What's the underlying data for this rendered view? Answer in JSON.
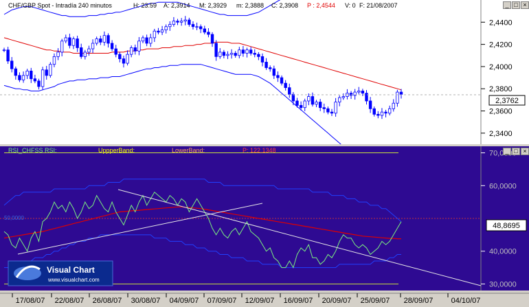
{
  "price_header": {
    "instrument": "CHF/GBP Spot - Intradía 240 minutos",
    "h": "H: 23:59",
    "a": "A: 2,3914",
    "m": "M: 2,3929",
    "mn": "m: 2,3888",
    "c": "C: 2,3908",
    "p": "P : 2,4544",
    "v": "V: 0",
    "date": "F: 21/08/2007"
  },
  "rsi_header": {
    "label": "RSI_CHFSS  RSI:",
    "upper": "UppperBand:",
    "lower": "LowerBand:",
    "p": "P: 122,1348"
  },
  "price_axis": [
    "2,4400",
    "2,4200",
    "2,4000",
    "2,3800",
    "2,3600",
    "2,3400"
  ],
  "price_last": "2,3762",
  "rsi_axis": [
    "70,0000",
    "60,0000",
    "48,8695",
    "40,0000",
    "30,0000"
  ],
  "rsi_label_left": "50,0000",
  "dates": [
    "17/08/07",
    "22/08/07",
    "26/08/07",
    "30/08/07",
    "04/09/07",
    "07/09/07",
    "12/09/07",
    "16/09/07",
    "20/09/07",
    "25/09/07",
    "28/09/07",
    "04/10/07"
  ],
  "logo": {
    "title": "Visual Chart",
    "url": "www.visualchart.com"
  },
  "colors": {
    "panel_bg": "#ffffff",
    "rsi_bg": "#2e0a92",
    "candle": "#0000ff",
    "ma": "#e00000",
    "band": "#0000ff",
    "rsi_line": "#7cf080",
    "level": "#c8e03c"
  },
  "chart_data": [
    {
      "type": "candlestick",
      "title": "CHF/GBP Spot - Intradía 240 minutos",
      "ylim": [
        2.33,
        2.46
      ],
      "close": [
        2.415,
        2.405,
        2.398,
        2.392,
        2.388,
        2.392,
        2.396,
        2.389,
        2.387,
        2.382,
        2.397,
        2.392,
        2.402,
        2.409,
        2.413,
        2.423,
        2.426,
        2.419,
        2.425,
        2.417,
        2.409,
        2.413,
        2.416,
        2.421,
        2.425,
        2.422,
        2.428,
        2.421,
        2.416,
        2.411,
        2.407,
        2.403,
        2.411,
        2.417,
        2.414,
        2.423,
        2.426,
        2.421,
        2.426,
        2.432,
        2.431,
        2.433,
        2.436,
        2.438,
        2.441,
        2.44,
        2.441,
        2.442,
        2.438,
        2.436,
        2.436,
        2.434,
        2.431,
        2.429,
        2.421,
        2.409,
        2.413,
        2.41,
        2.411,
        2.412,
        2.41,
        2.415,
        2.412,
        2.415,
        2.412,
        2.411,
        2.409,
        2.404,
        2.399,
        2.398,
        2.392,
        2.39,
        2.385,
        2.381,
        2.375,
        2.369,
        2.365,
        2.363,
        2.369,
        2.373,
        2.366,
        2.368,
        2.363,
        2.362,
        2.359,
        2.358,
        2.368,
        2.372,
        2.373,
        2.376,
        2.374,
        2.377,
        2.378,
        2.376,
        2.369,
        2.362,
        2.357,
        2.356,
        2.359,
        2.358,
        2.362,
        2.367,
        2.377,
        2.375
      ],
      "ma": [
        2.426,
        2.425,
        2.424,
        2.423,
        2.422,
        2.421,
        2.42,
        2.419,
        2.418,
        2.417,
        2.416,
        2.415,
        2.415,
        2.414,
        2.414,
        2.413,
        2.413,
        2.413,
        2.412,
        2.412,
        2.412,
        2.412,
        2.412,
        2.412,
        2.412,
        2.412,
        2.412,
        2.412,
        2.413,
        2.413,
        2.413,
        2.413,
        2.414,
        2.414,
        2.414,
        2.415,
        2.415,
        2.416,
        2.416,
        2.416,
        2.416,
        2.417,
        2.417,
        2.417,
        2.418,
        2.418,
        2.418,
        2.419,
        2.419,
        2.419,
        2.42,
        2.42,
        2.421,
        2.421,
        2.421,
        2.422,
        2.422,
        2.422,
        2.422,
        2.421,
        2.421,
        2.421,
        2.42,
        2.419,
        2.418,
        2.417,
        2.416,
        2.415,
        2.414,
        2.413,
        2.412,
        2.411,
        2.41,
        2.409,
        2.408,
        2.407,
        2.406,
        2.405,
        2.404,
        2.403,
        2.402,
        2.401,
        2.4,
        2.399,
        2.398,
        2.397,
        2.396,
        2.395,
        2.394,
        2.393,
        2.392,
        2.391,
        2.39,
        2.389,
        2.388,
        2.387,
        2.386,
        2.385,
        2.384,
        2.383,
        2.382,
        2.381,
        2.38,
        2.379
      ],
      "upper_band": [
        2.447,
        2.449,
        2.451,
        2.452,
        2.453,
        2.454,
        2.454,
        2.454,
        2.453,
        2.452,
        2.451,
        2.45,
        2.449,
        2.448,
        2.447,
        2.446,
        2.446,
        2.445,
        2.445,
        2.445,
        2.445,
        2.445,
        2.446,
        2.446,
        2.446,
        2.447,
        2.447,
        2.448,
        2.448,
        2.449,
        2.449,
        2.45,
        2.451,
        2.452,
        2.453,
        2.454,
        2.455,
        2.456,
        2.457,
        2.457,
        2.458,
        2.458,
        2.458,
        2.458,
        2.458,
        2.458,
        2.457,
        2.456,
        2.455,
        2.454,
        2.453,
        2.452,
        2.451,
        2.45,
        2.449,
        2.448,
        2.447,
        2.447,
        2.446,
        2.446,
        2.446,
        2.446,
        2.446,
        2.446,
        2.447,
        2.448,
        2.449,
        2.451,
        2.453,
        2.455,
        2.457,
        2.459,
        2.461,
        2.463,
        2.465,
        2.467,
        2.469,
        2.471,
        2.473,
        2.475,
        2.477,
        2.479,
        2.481,
        2.483,
        2.485,
        2.487,
        2.489,
        2.491,
        2.493,
        2.495,
        2.497,
        2.499,
        2.501,
        2.503,
        2.505,
        2.507,
        2.509,
        2.511,
        2.513,
        2.515,
        2.517,
        2.519,
        2.521,
        2.523
      ],
      "lower_band": [
        2.383,
        2.382,
        2.381,
        2.38,
        2.38,
        2.379,
        2.379,
        2.378,
        2.378,
        2.378,
        2.379,
        2.38,
        2.381,
        2.382,
        2.384,
        2.385,
        2.386,
        2.387,
        2.387,
        2.388,
        2.388,
        2.388,
        2.389,
        2.389,
        2.389,
        2.39,
        2.39,
        2.39,
        2.391,
        2.391,
        2.391,
        2.392,
        2.393,
        2.394,
        2.395,
        2.396,
        2.397,
        2.398,
        2.398,
        2.399,
        2.399,
        2.4,
        2.4,
        2.401,
        2.401,
        2.401,
        2.402,
        2.402,
        2.402,
        2.402,
        2.402,
        2.402,
        2.401,
        2.4,
        2.399,
        2.398,
        2.397,
        2.396,
        2.395,
        2.394,
        2.393,
        2.393,
        2.393,
        2.393,
        2.393,
        2.392,
        2.391,
        2.389,
        2.387,
        2.385,
        2.382,
        2.379,
        2.376,
        2.373,
        2.37,
        2.367,
        2.364,
        2.361,
        2.358,
        2.355,
        2.352,
        2.349,
        2.346,
        2.343,
        2.34,
        2.337,
        2.334,
        2.331,
        2.328,
        2.325,
        2.322,
        2.319,
        2.316,
        2.313,
        2.31,
        2.307,
        2.304,
        2.301,
        2.298,
        2.295,
        2.292,
        2.289,
        2.286,
        2.283
      ]
    },
    {
      "type": "line",
      "title": "RSI_CHFSS",
      "ylim": [
        28,
        72
      ],
      "levels": [
        70,
        30
      ],
      "reference": 50,
      "rsi": [
        46,
        45,
        42,
        41,
        44,
        42,
        40,
        44,
        46,
        43,
        49,
        50,
        52,
        55,
        53,
        54,
        52,
        55,
        53,
        50,
        52,
        55,
        53,
        54,
        57,
        55,
        53,
        52,
        55,
        52,
        50,
        48,
        51,
        54,
        52,
        55,
        57,
        54,
        56,
        58,
        57,
        56,
        55,
        57,
        56,
        54,
        56,
        55,
        52,
        54,
        56,
        54,
        52,
        50,
        47,
        45,
        47,
        45,
        44,
        46,
        47,
        45,
        47,
        49,
        46,
        45,
        44,
        42,
        40,
        41,
        38,
        37,
        35,
        35,
        37,
        35,
        39,
        41,
        40,
        42,
        38,
        38,
        36,
        37,
        39,
        38,
        40,
        43,
        45,
        44,
        44,
        42,
        41,
        42,
        41,
        39,
        40,
        41,
        43,
        42,
        43,
        45,
        47,
        49
      ],
      "ma": [
        44.0,
        44.2,
        44.4,
        44.6,
        44.8,
        45.0,
        45.2,
        45.4,
        45.6,
        45.8,
        46.0,
        46.3,
        46.6,
        46.9,
        47.2,
        47.5,
        47.8,
        48.1,
        48.4,
        48.7,
        49.0,
        49.3,
        49.6,
        49.9,
        50.2,
        50.5,
        50.8,
        51.1,
        51.4,
        51.7,
        52.0,
        52.1,
        52.2,
        52.3,
        52.4,
        52.5,
        52.6,
        52.7,
        52.8,
        52.9,
        53.0,
        53.1,
        53.2,
        53.3,
        53.4,
        53.5,
        53.5,
        53.4,
        53.3,
        53.2,
        53.1,
        53.0,
        52.8,
        52.6,
        52.4,
        52.2,
        52.0,
        51.8,
        51.6,
        51.4,
        51.2,
        51.0,
        50.8,
        50.6,
        50.4,
        50.2,
        50.0,
        49.8,
        49.6,
        49.4,
        49.2,
        49.0,
        48.8,
        48.6,
        48.4,
        48.2,
        48.0,
        47.8,
        47.6,
        47.4,
        47.2,
        47.0,
        46.8,
        46.6,
        46.4,
        46.2,
        46.0,
        45.8,
        45.6,
        45.4,
        45.2,
        45.0,
        44.8,
        44.6,
        44.5,
        44.4,
        44.3,
        44.2,
        44.1,
        44.0,
        43.9,
        43.9,
        43.8,
        43.8
      ],
      "upper_band": [
        54,
        55,
        56,
        57,
        57,
        58,
        58,
        58,
        58,
        58,
        58,
        58,
        58,
        59,
        59,
        59,
        59,
        59,
        59,
        59,
        59,
        59,
        60,
        60,
        60,
        60,
        60,
        61,
        61,
        61,
        61,
        62,
        62,
        62,
        62,
        62,
        62,
        62,
        62,
        62,
        62,
        62,
        62,
        62,
        62,
        62,
        62,
        62,
        62,
        62,
        62,
        62,
        62,
        61,
        61,
        61,
        61,
        60,
        60,
        60,
        60,
        60,
        60,
        60,
        60,
        60,
        60,
        60,
        60,
        60,
        60,
        59,
        59,
        59,
        59,
        59,
        59,
        59,
        59,
        59,
        58,
        58,
        58,
        58,
        58,
        57,
        57,
        57,
        57,
        56,
        56,
        56,
        55,
        55,
        55,
        54,
        54,
        54,
        53,
        53,
        52,
        51,
        50,
        49
      ],
      "lower_band": [
        35,
        35,
        36,
        36,
        36,
        37,
        37,
        37,
        38,
        38,
        38,
        39,
        39,
        40,
        40,
        41,
        41,
        42,
        42,
        43,
        43,
        43,
        44,
        44,
        44,
        45,
        45,
        45,
        45,
        45,
        45,
        45,
        45,
        45,
        45,
        45,
        45,
        45,
        45,
        44,
        44,
        44,
        44,
        43,
        43,
        43,
        43,
        42,
        42,
        42,
        41,
        41,
        41,
        40,
        40,
        40,
        39,
        39,
        39,
        38,
        38,
        38,
        38,
        37,
        37,
        37,
        37,
        36,
        36,
        36,
        36,
        36,
        35,
        35,
        35,
        35,
        35,
        35,
        35,
        35,
        35,
        35,
        35,
        35,
        35,
        35,
        35,
        36,
        36,
        36,
        36,
        36,
        36,
        36,
        36,
        36,
        37,
        37,
        37,
        37,
        38,
        38,
        39,
        39
      ]
    }
  ]
}
